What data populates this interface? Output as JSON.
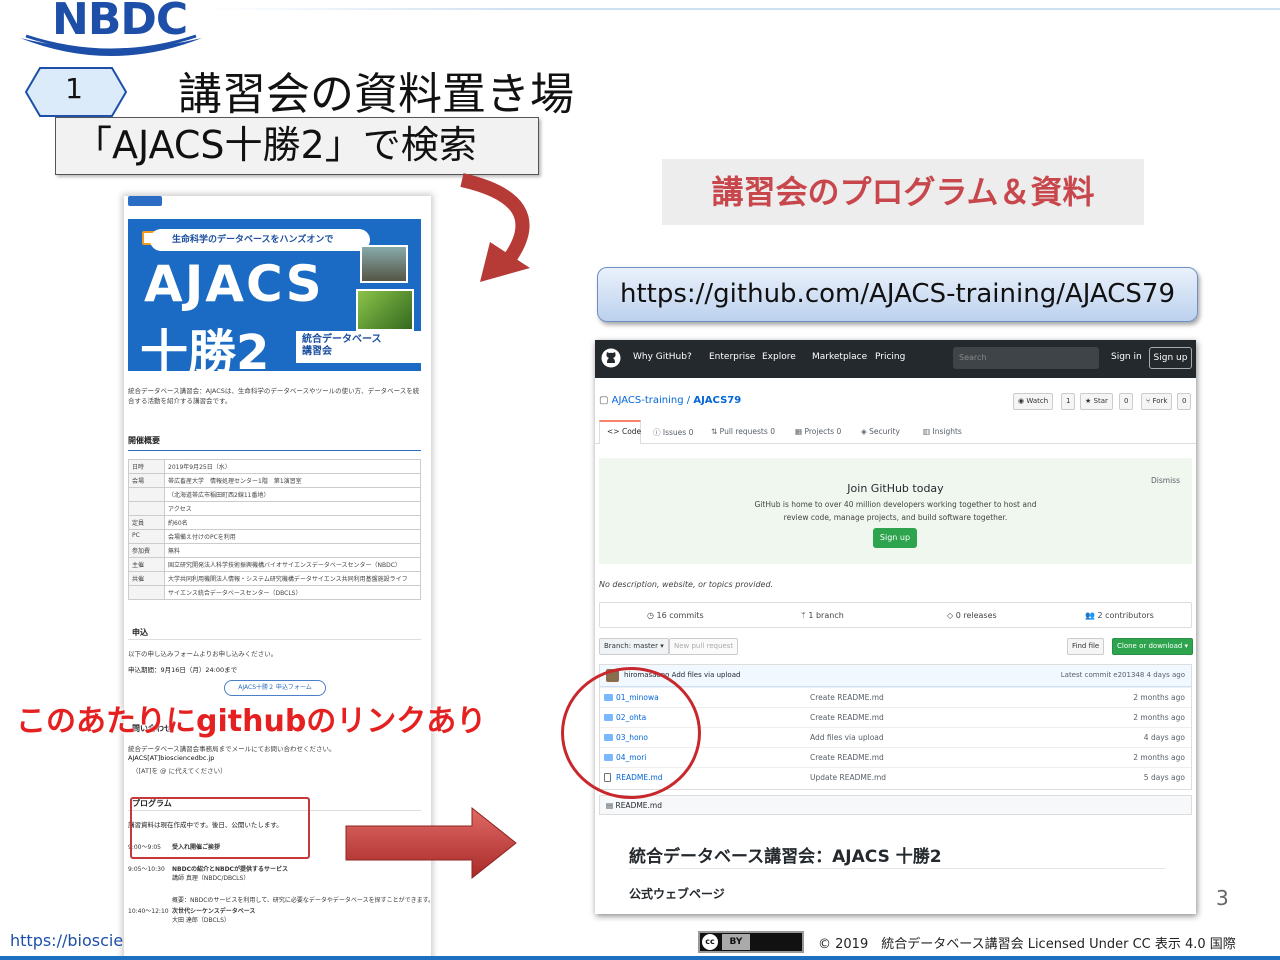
{
  "header": {
    "logo_text": "NBDC",
    "slide_number_badge": "1",
    "title": "講習会の資料置き場",
    "search_hint": "「AJACS十勝2」で検索",
    "program_label": "講習会のプログラム＆資料",
    "github_url": "https://github.com/AJACS-training/AJACS79"
  },
  "event_page": {
    "banner_tagline": "生命科学のデータベースをハンズオンで",
    "banner_title_line1": "AJACS",
    "banner_title_line2": "十勝2",
    "banner_sub1": "統合データベース",
    "banner_sub2": "講習会",
    "intro": "統合データベース講習会：AJACSは、生命科学のデータベースやツールの使い方、データベースを統合する活動を紹介する講習会です。",
    "section_overview": "開催概要",
    "table": [
      {
        "key": "日時",
        "val": "2019年9月25日（水）"
      },
      {
        "key": "会場",
        "val": "帯広畜産大学　情報処理センター1階　第1演習室"
      },
      {
        "key": "",
        "val": "（北海道帯広市稲田町西2線11番地）"
      },
      {
        "key": "",
        "val": "アクセス"
      },
      {
        "key": "定員",
        "val": "約60名"
      },
      {
        "key": "PC",
        "val": "会場備え付けのPCを利用"
      },
      {
        "key": "参加費",
        "val": "無料"
      },
      {
        "key": "主催",
        "val": "国立研究開発法人科学技術振興機構バイオサイエンスデータベースセンター（NBDC）"
      },
      {
        "key": "共催",
        "val": "大学共同利用機関法人情報・システム研究機構データサイエンス共同利用基盤施設ライフ"
      },
      {
        "key": "",
        "val": "サイエンス統合データベースセンター（DBCLS）"
      }
    ],
    "section_apply": "申込",
    "apply_text": "以下の申し込みフォームよりお申し込みください。",
    "deadline": "申込期間：9月16日（月）24:00まで",
    "form_button": "AJACS十勝２ 申込フォーム",
    "section_contact": "問い合わせ",
    "contact_text": "統合データベース講習会事務局までメールにてお問い合わせください。",
    "contact_mail": "AJACS[AT]biosciencedbc.jp",
    "contact_note": "（[AT]を @ に代えてください）",
    "section_program": "プログラム",
    "program_note": "講習資料は現在作成中です。後日、公開いたします。",
    "schedule": [
      {
        "time": "9:00〜9:05",
        "title": "受入れ開催ご挨拶",
        "detail": ""
      },
      {
        "time": "9:05〜10:30",
        "title": "NBDCの紹介とNBDCが提供するサービス",
        "detail": "講師 真理（NBDC/DBCLS）"
      },
      {
        "time": "",
        "title": "",
        "detail": "概要：NBDCのサービスを利用して、研究に必要なデータやデータベースを探すことができます。"
      },
      {
        "time": "10:40〜12:10",
        "title": "次世代シーケンスデータベース",
        "detail": "大田 達郎（DBCLS）"
      }
    ]
  },
  "github": {
    "nav": [
      "Why GitHub?",
      "Enterprise",
      "Explore",
      "Marketplace",
      "Pricing"
    ],
    "search_placeholder": "Search",
    "sign_in": "Sign in",
    "sign_up": "Sign up",
    "repo_owner": "AJACS-training",
    "repo_sep": " / ",
    "repo_name": "AJACS79",
    "watch": {
      "label": "Watch",
      "count": "1"
    },
    "star": {
      "label": "Star",
      "count": "0"
    },
    "fork": {
      "label": "Fork",
      "count": "0"
    },
    "tabs": [
      {
        "label": "Code",
        "count": ""
      },
      {
        "label": "Issues",
        "count": "0"
      },
      {
        "label": "Pull requests",
        "count": "0"
      },
      {
        "label": "Projects",
        "count": "0"
      },
      {
        "label": "Security",
        "count": ""
      },
      {
        "label": "Insights",
        "count": ""
      }
    ],
    "join_title": "Join GitHub today",
    "join_text1": "GitHub is home to over 40 million developers working together to host and",
    "join_text2": "review code, manage projects, and build software together.",
    "join_button": "Sign up",
    "dismiss": "Dismiss",
    "description": "No description, website, or topics provided.",
    "stats": [
      "16 commits",
      "1 branch",
      "0 releases",
      "2 contributors"
    ],
    "branch_button": "Branch: master",
    "new_pr": "New pull request",
    "find_file": "Find file",
    "clone": "Clone or download",
    "commit_author": "hiromasaono",
    "commit_msg": "Add files via upload",
    "latest_commit": "Latest commit e201348 4 days ago",
    "files": [
      {
        "name": "01_minowa",
        "msg": "Create README.md",
        "age": "2 months ago",
        "type": "dir"
      },
      {
        "name": "02_ohta",
        "msg": "Create README.md",
        "age": "2 months ago",
        "type": "dir"
      },
      {
        "name": "03_hono",
        "msg": "Add files via upload",
        "age": "4 days ago",
        "type": "dir"
      },
      {
        "name": "04_mori",
        "msg": "Create README.md",
        "age": "2 months ago",
        "type": "dir"
      },
      {
        "name": "README.md",
        "msg": "Update README.md",
        "age": "5 days ago",
        "type": "file"
      }
    ],
    "readme_label": "README.md",
    "readme_title": "統合データベース講習会：AJACS 十勝2",
    "readme_sub": "公式ウェブページ"
  },
  "annotation": {
    "note": "このあたりにgithubのリンクあり"
  },
  "footer": {
    "url": "https://bioscie",
    "page": "3",
    "cc": "BY",
    "copyright": "© 2019　統合データベース講習会 Licensed Under CC 表示 4.0 国際"
  },
  "colors": {
    "brand_blue": "#1d4fa8",
    "accent_red": "#c8474c",
    "note_red": "#e52020",
    "github_dark": "#24292e",
    "github_green": "#2ea44f"
  }
}
